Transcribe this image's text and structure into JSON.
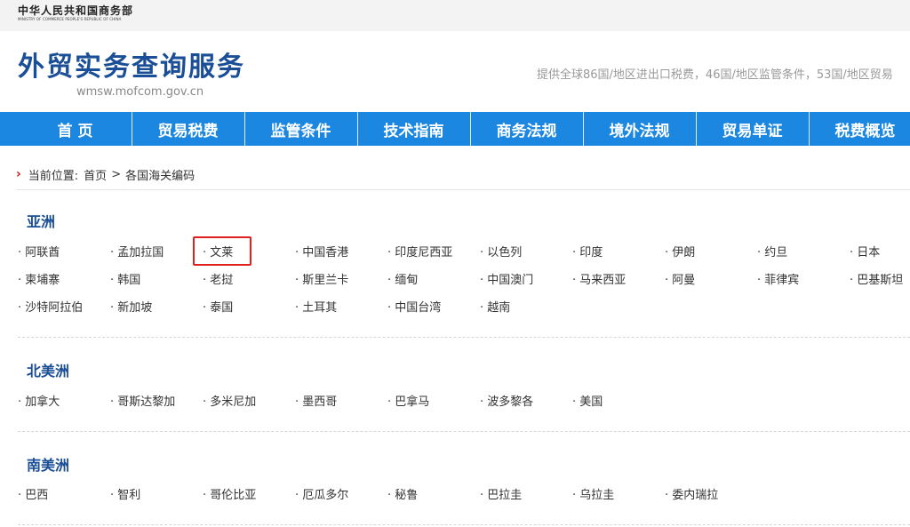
{
  "header": {
    "ministry_cn": "中华人民共和国商务部",
    "ministry_en": "MINISTRY OF COMMERCE PEOPLE'S REPUBLIC OF CHINA",
    "site_title": "外贸实务查询服务",
    "site_url": "wmsw.mofcom.gov.cn",
    "site_desc": "提供全球86国/地区进出口税费，46国/地区监管条件，53国/地区贸易"
  },
  "nav": {
    "items": [
      "首 页",
      "贸易税费",
      "监管条件",
      "技术指南",
      "商务法规",
      "境外法规",
      "贸易单证",
      "税费概览"
    ]
  },
  "breadcrumb": {
    "arrow": "›",
    "label": "当前位置:",
    "home": "首页",
    "separator": ">",
    "current": "各国海关编码"
  },
  "regions": [
    {
      "name": "亚洲",
      "countries": [
        "阿联酋",
        "孟加拉国",
        "文莱",
        "中国香港",
        "印度尼西亚",
        "以色列",
        "印度",
        "伊朗",
        "约旦",
        "日本",
        "柬埔寨",
        "韩国",
        "老挝",
        "斯里兰卡",
        "缅甸",
        "中国澳门",
        "马来西亚",
        "阿曼",
        "菲律宾",
        "巴基斯坦",
        "沙特阿拉伯",
        "新加坡",
        "泰国",
        "土耳其",
        "中国台湾",
        "越南"
      ]
    },
    {
      "name": "北美洲",
      "countries": [
        "加拿大",
        "哥斯达黎加",
        "多米尼加",
        "墨西哥",
        "巴拿马",
        "波多黎各",
        "美国"
      ]
    },
    {
      "name": "南美洲",
      "countries": [
        "巴西",
        "智利",
        "哥伦比亚",
        "厄瓜多尔",
        "秘鲁",
        "巴拉圭",
        "乌拉圭",
        "委内瑞拉"
      ]
    }
  ],
  "bullet": "·",
  "colors": {
    "nav_bg": "#1b87e0",
    "title_blue": "#1a4e96",
    "highlight_red": "#e02020",
    "breadcrumb_arrow": "#cc1111"
  }
}
